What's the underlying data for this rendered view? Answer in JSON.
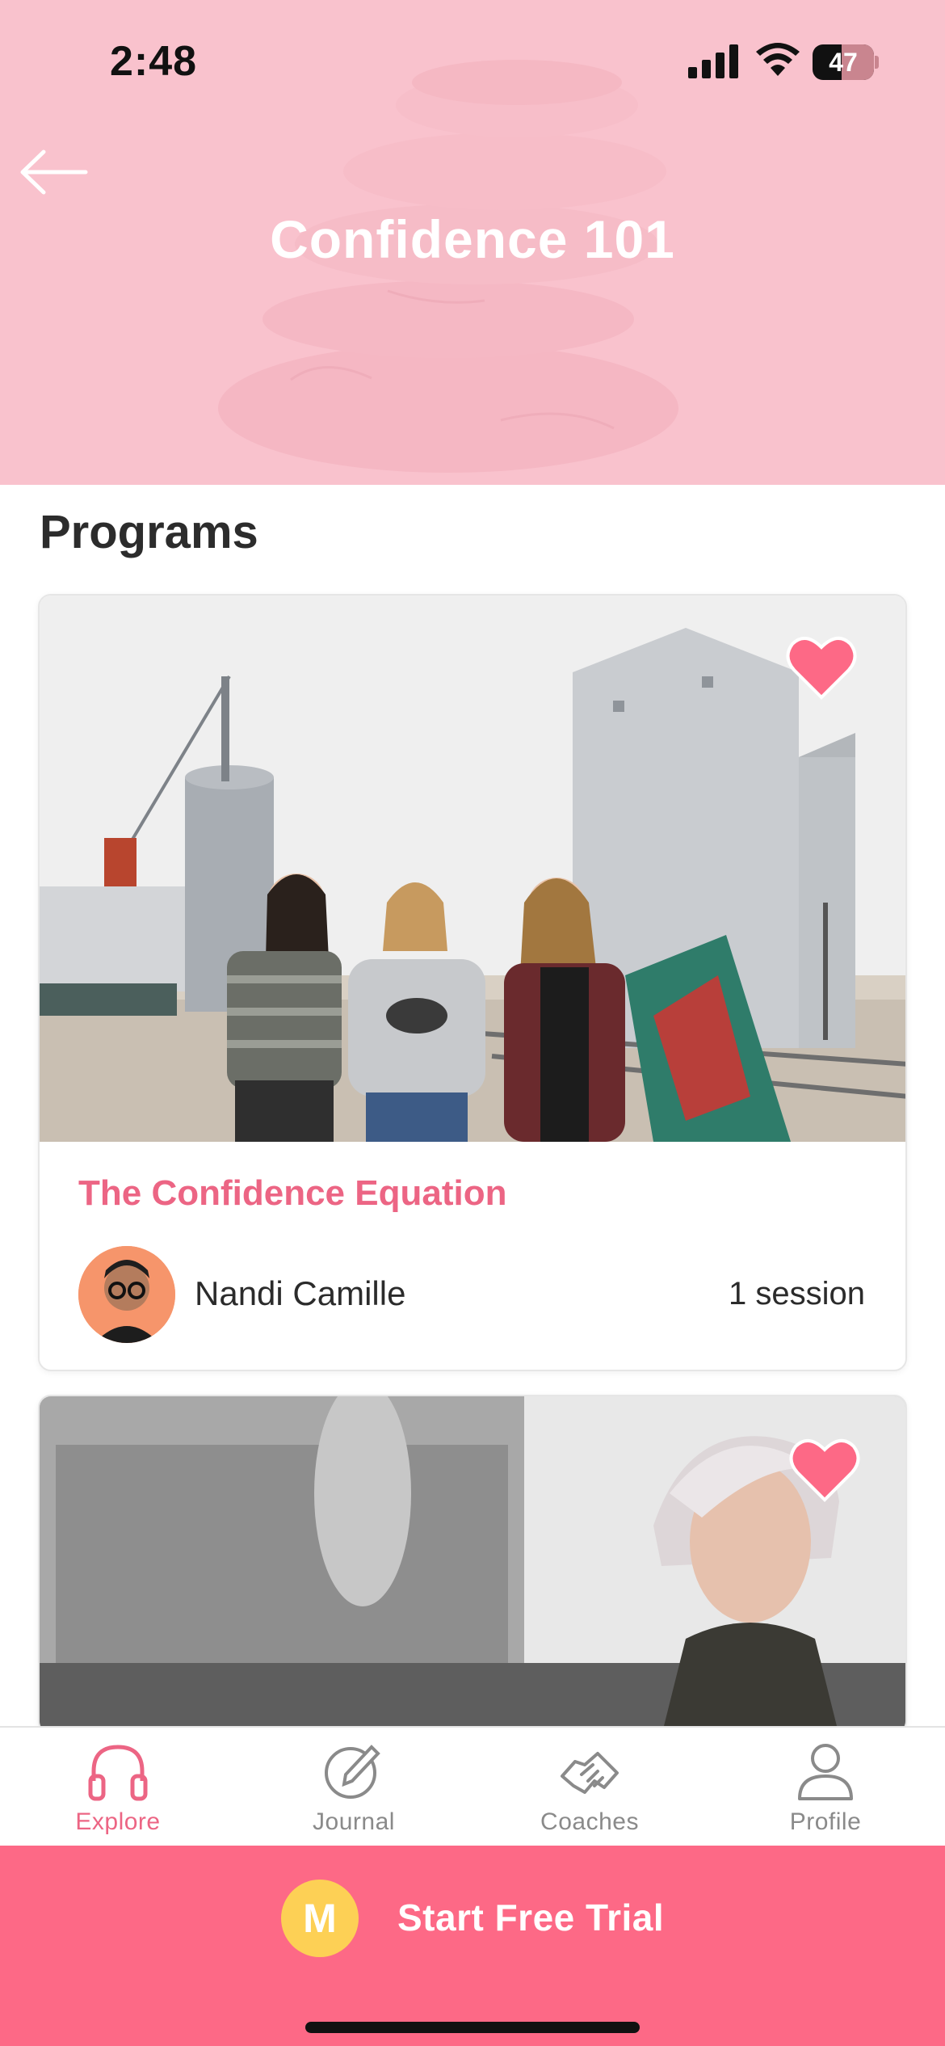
{
  "status_bar": {
    "time": "2:48",
    "battery": "47",
    "battery_level": 0.47
  },
  "header": {
    "title": "Confidence 101",
    "background_color": "#f9c2cd"
  },
  "programs": {
    "section_title": "Programs",
    "cards": [
      {
        "title": "The Confidence Equation",
        "author": "Nandi Camille",
        "sessions": "1 session",
        "favorited": true
      },
      {
        "title": "",
        "favorited": true
      }
    ]
  },
  "tab_bar": {
    "tabs": [
      {
        "label": "Explore",
        "icon": "headphones-icon",
        "active": true
      },
      {
        "label": "Journal",
        "icon": "pencil-circle-icon",
        "active": false
      },
      {
        "label": "Coaches",
        "icon": "handshake-icon",
        "active": false
      },
      {
        "label": "Profile",
        "icon": "person-icon",
        "active": false
      }
    ]
  },
  "trial": {
    "label": "Start Free Trial",
    "logo_letter": "M",
    "background_color": "#fd6986",
    "logo_color": "#fdd055"
  },
  "colors": {
    "accent": "#ec6584",
    "inactive_tab": "#8a8a8a"
  }
}
